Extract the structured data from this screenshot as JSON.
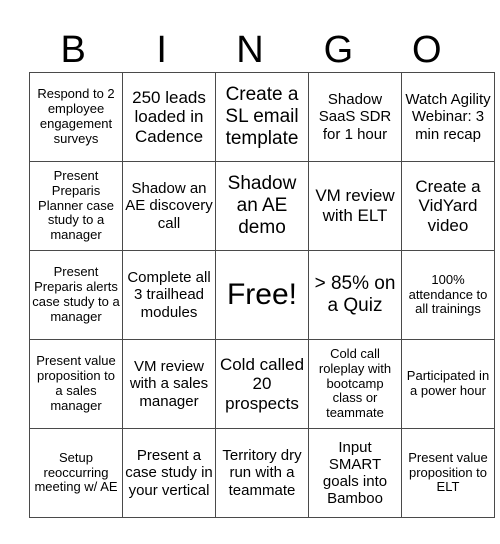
{
  "header": [
    "B",
    "I",
    "N",
    "G",
    "O"
  ],
  "rows": [
    [
      "Respond to 2 employee engagement surveys",
      "250 leads loaded in Cadence",
      "Create a SL email template",
      "Shadow SaaS SDR for 1 hour",
      "Watch Agility Webinar: 3 min recap"
    ],
    [
      "Present Preparis Planner case study to a manager",
      "Shadow an AE discovery call",
      "Shadow an AE demo",
      "VM review with ELT",
      "Create a VidYard video"
    ],
    [
      "Present Preparis alerts case study to a manager",
      "Complete all 3 trailhead modules",
      "Free!",
      "> 85% on a Quiz",
      "100% attendance to all trainings"
    ],
    [
      "Present value proposition to a sales manager",
      "VM review with a sales manager",
      "Cold called 20 prospects",
      "Cold call roleplay with bootcamp class or teammate",
      "Participated in a power hour"
    ],
    [
      "Setup reoccurring meeting w/ AE",
      "Present a case study in your vertical",
      "Territory dry run with a teammate",
      "Input SMART goals into Bamboo",
      "Present value proposition to ELT"
    ]
  ]
}
